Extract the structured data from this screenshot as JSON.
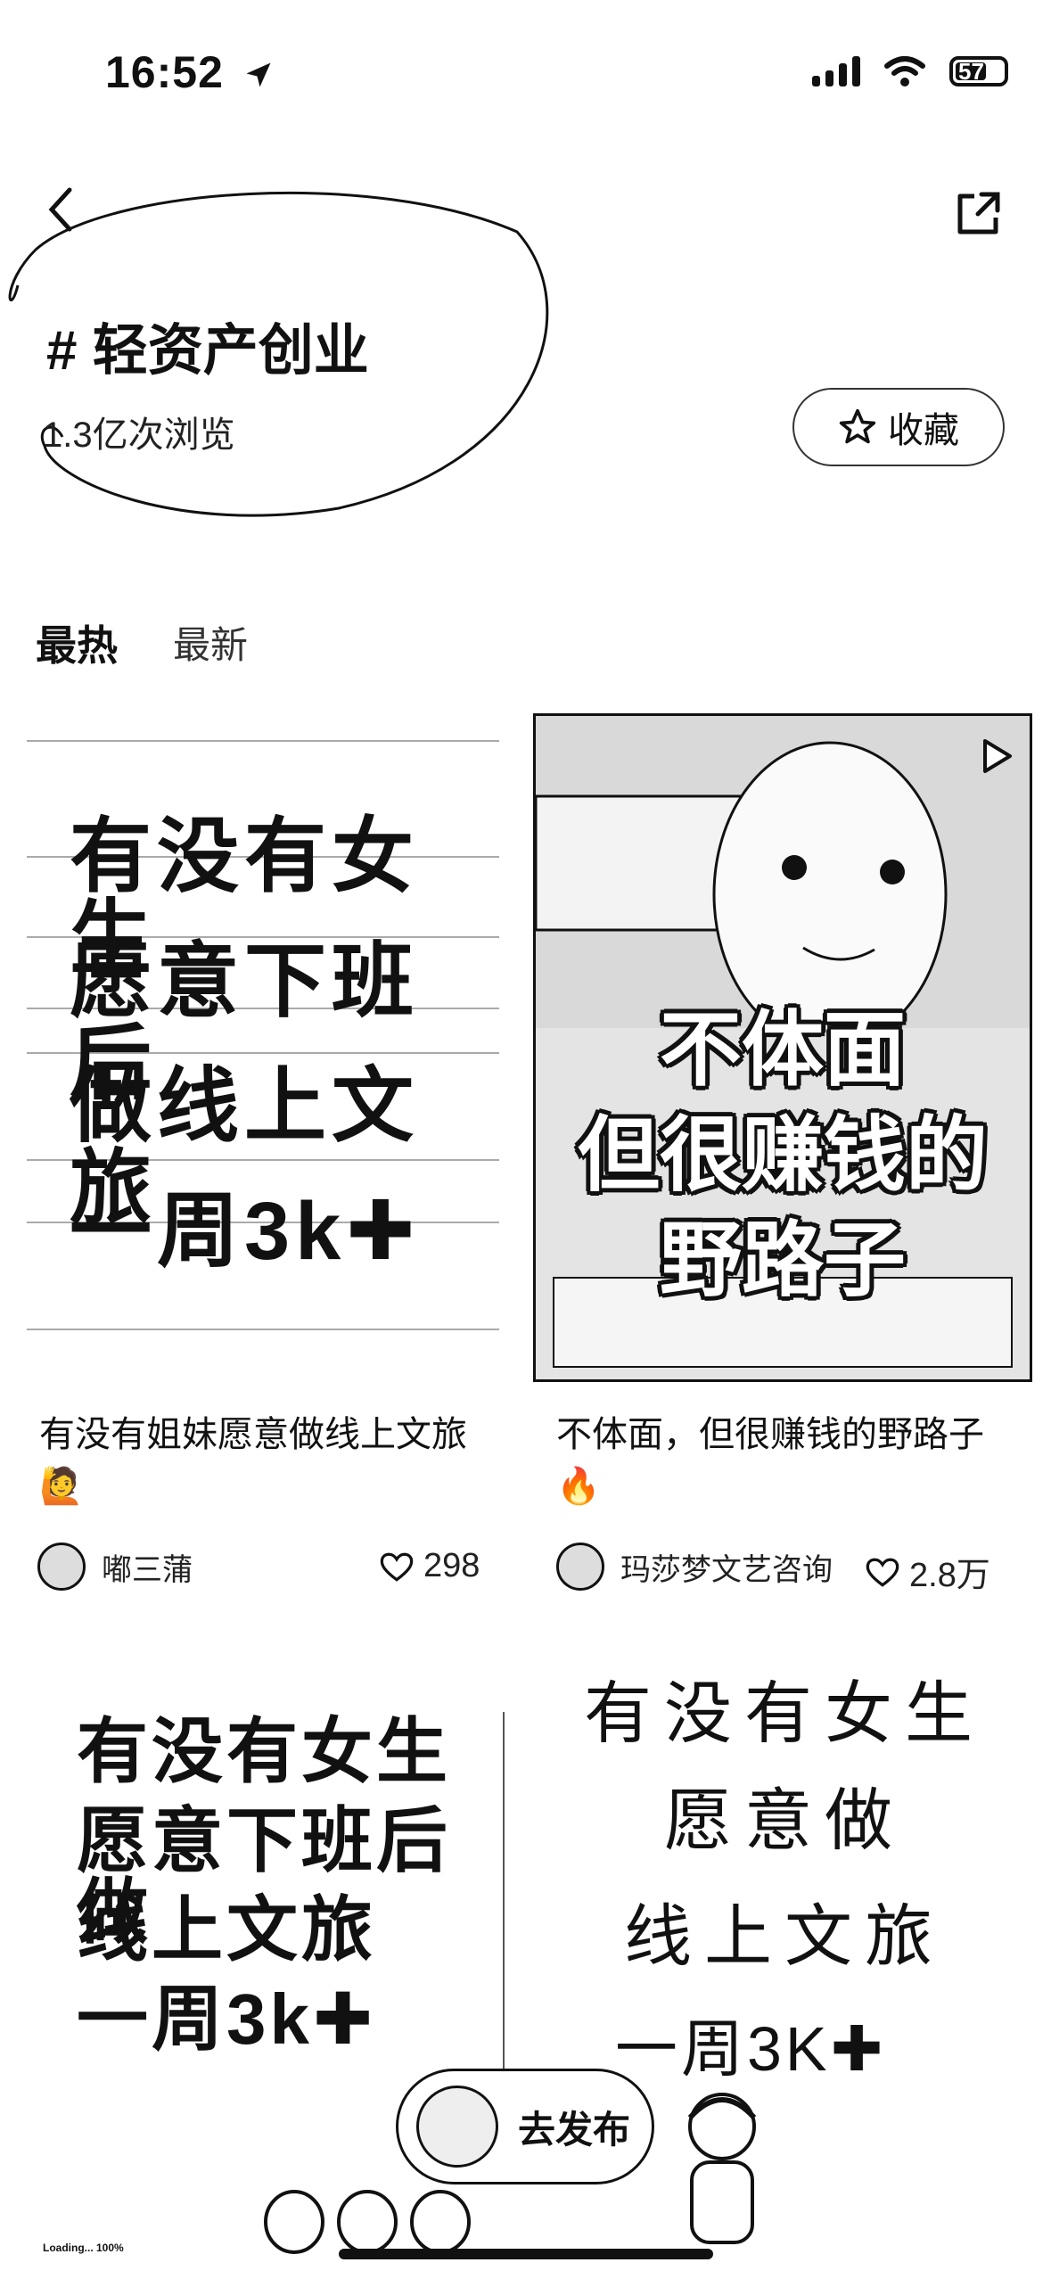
{
  "status_bar": {
    "time": "16:52",
    "battery": "57"
  },
  "header": {
    "topic": "# 轻资产创业",
    "views": "1.3亿次浏览",
    "favorite_label": "收藏"
  },
  "tabs": [
    {
      "label": "最热"
    },
    {
      "label": "最新"
    }
  ],
  "posts": [
    {
      "cover_lines": [
        "有没有女生",
        "愿意下班后",
        "做线上文旅",
        "一周3k✚"
      ],
      "caption": "有没有姐妹愿意做线上文旅🙋",
      "author": "嘟三蒲",
      "likes": "298"
    },
    {
      "cover_lines": [
        "不体面",
        "但很赚钱的",
        "野路子"
      ],
      "caption": "不体面，但很赚钱的野路子🔥",
      "author": "玛莎梦文艺咨询",
      "likes": "2.8万"
    },
    {
      "cover_lines": [
        "有没有女生",
        "愿意下班后做",
        "线上文旅",
        "一周3k✚"
      ]
    },
    {
      "cover_lines": [
        "有没有女生",
        "愿意做",
        "线上文旅",
        "一周3K✚"
      ]
    }
  ],
  "publish_button": "去发布",
  "loading_text": "Loading... 100%"
}
